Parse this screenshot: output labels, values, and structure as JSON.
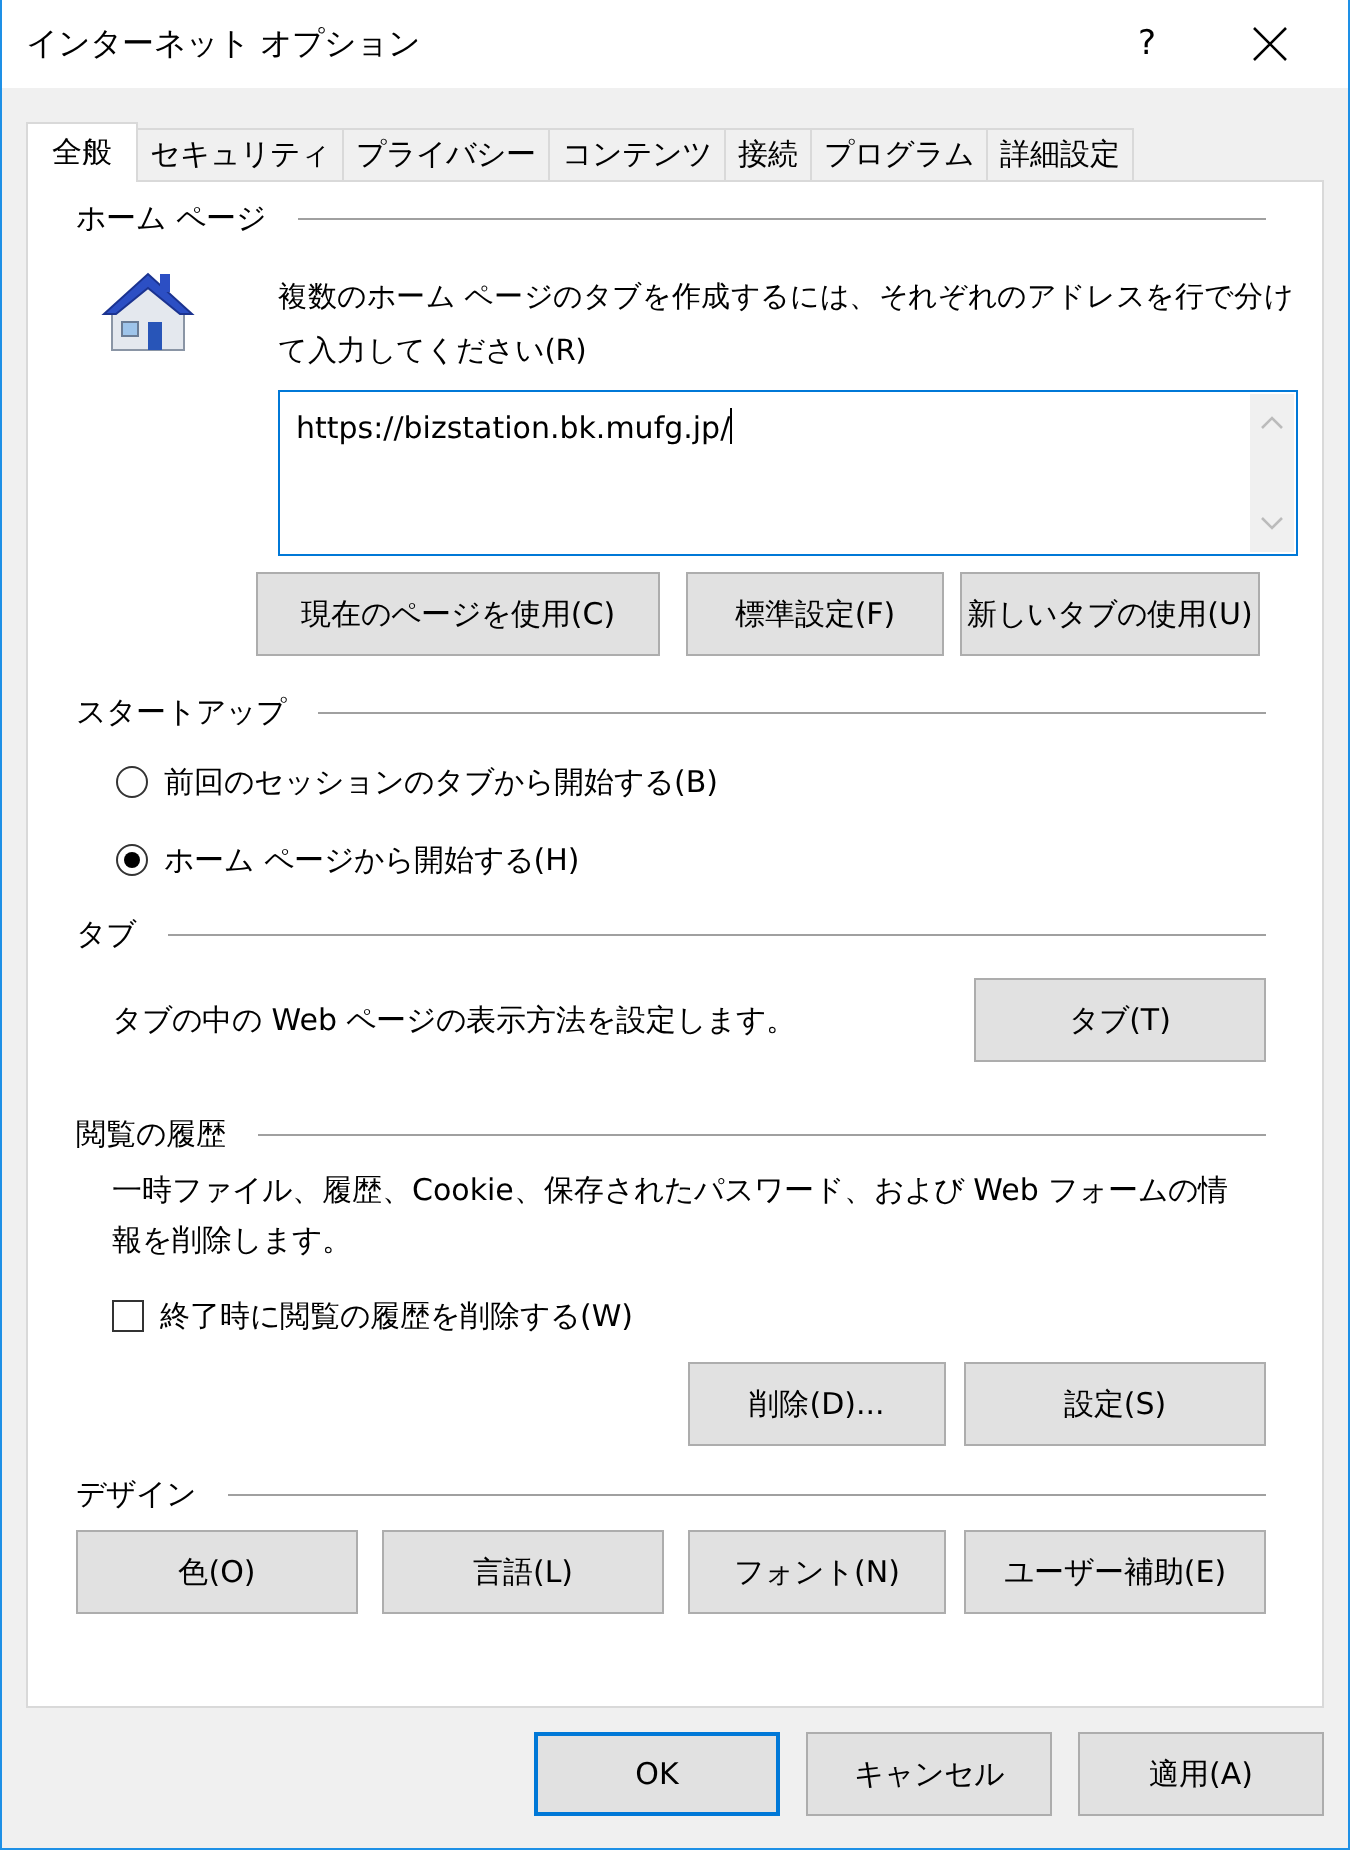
{
  "window": {
    "title": "インターネット オプション",
    "help": "?"
  },
  "tabs": [
    {
      "label": "全般",
      "selected": true
    },
    {
      "label": "セキュリティ",
      "selected": false
    },
    {
      "label": "プライバシー",
      "selected": false
    },
    {
      "label": "コンテンツ",
      "selected": false
    },
    {
      "label": "接続",
      "selected": false
    },
    {
      "label": "プログラム",
      "selected": false
    },
    {
      "label": "詳細設定",
      "selected": false
    }
  ],
  "home_page": {
    "title": "ホーム ページ",
    "description": "複数のホーム ページのタブを作成するには、それぞれのアドレスを行で分けて入力してください(R)",
    "value": "https://bizstation.bk.mufg.jp/",
    "buttons": [
      "現在のページを使用(C)",
      "標準設定(F)",
      "新しいタブの使用(U)"
    ]
  },
  "startup": {
    "title": "スタートアップ",
    "options": [
      {
        "label": "前回のセッションのタブから開始する(B)",
        "selected": false
      },
      {
        "label": "ホーム ページから開始する(H)",
        "selected": true
      }
    ]
  },
  "tabs_section": {
    "title": "タブ",
    "description": "タブの中の Web ページの表示方法を設定します。",
    "button": "タブ(T)"
  },
  "history": {
    "title": "閲覧の履歴",
    "description": "一時ファイル、履歴、Cookie、保存されたパスワード、および Web フォームの情報を削除します。",
    "delete_on_exit": {
      "label": "終了時に閲覧の履歴を削除する(W)",
      "checked": false
    },
    "buttons": [
      "削除(D)...",
      "設定(S)"
    ]
  },
  "design": {
    "title": "デザイン",
    "buttons": [
      "色(O)",
      "言語(L)",
      "フォント(N)",
      "ユーザー補助(E)"
    ]
  },
  "footer": [
    {
      "label": "OK",
      "default": true
    },
    {
      "label": "キャンセル",
      "default": false
    },
    {
      "label": "適用(A)",
      "default": false
    }
  ]
}
